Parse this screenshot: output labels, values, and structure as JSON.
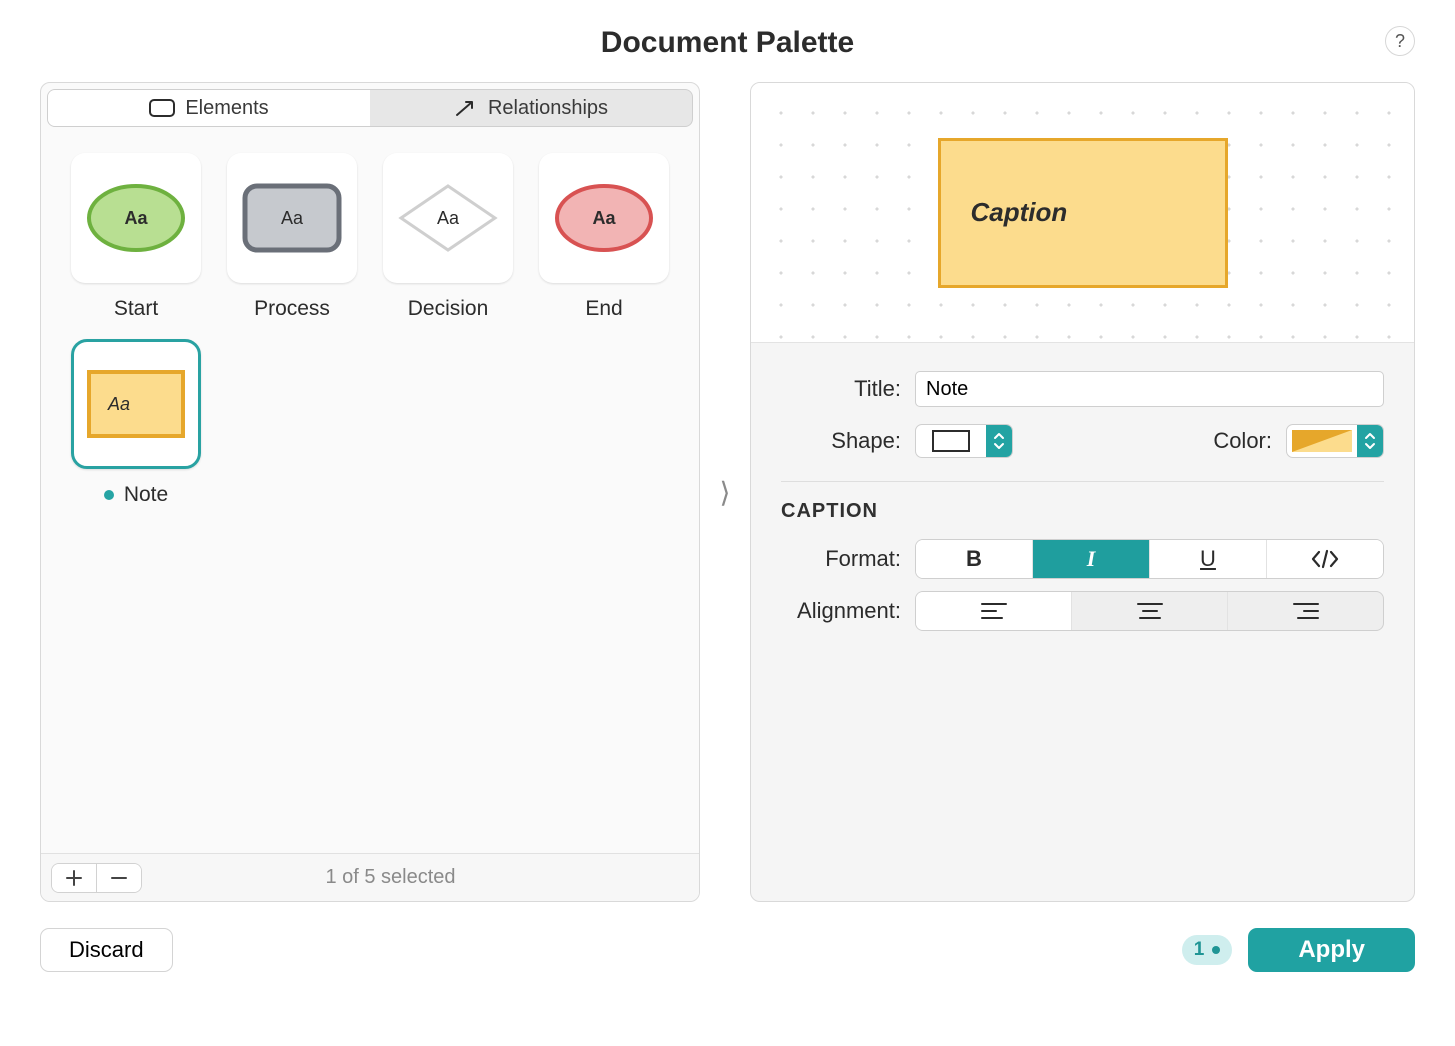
{
  "title": "Document Palette",
  "help_tooltip": "?",
  "tabs": {
    "elements": "Elements",
    "relationships": "Relationships",
    "active": "elements"
  },
  "elements": [
    {
      "id": "start",
      "label": "Start",
      "shape": "ellipse",
      "fill": "#b8df92",
      "stroke": "#6eb13f",
      "caption": "Aa",
      "bold": true,
      "italic": false,
      "selected": false,
      "modified": false
    },
    {
      "id": "process",
      "label": "Process",
      "shape": "roundrect",
      "fill": "#c6c9ce",
      "stroke": "#6a6f78",
      "caption": "Aa",
      "bold": false,
      "italic": false,
      "selected": false,
      "modified": false
    },
    {
      "id": "decision",
      "label": "Decision",
      "shape": "diamond",
      "fill": "#ffffff",
      "stroke": "#cfcfcf",
      "caption": "Aa",
      "bold": false,
      "italic": false,
      "selected": false,
      "modified": false
    },
    {
      "id": "end",
      "label": "End",
      "shape": "ellipse",
      "fill": "#f2b4b4",
      "stroke": "#d85252",
      "caption": "Aa",
      "bold": true,
      "italic": false,
      "selected": false,
      "modified": false
    },
    {
      "id": "note",
      "label": "Note",
      "shape": "rect",
      "fill": "#fcdc8d",
      "stroke": "#e6a72b",
      "caption": "Aa",
      "bold": false,
      "italic": true,
      "selected": true,
      "modified": true
    }
  ],
  "selection_status": "1 of 5 selected",
  "preview": {
    "caption": "Caption"
  },
  "props": {
    "title_label": "Title:",
    "title_value": "Note",
    "shape_label": "Shape:",
    "color_label": "Color:",
    "color_value": "#fcdc8d",
    "color_accent": "#e6a72b"
  },
  "caption_section": {
    "heading": "CAPTION",
    "format_label": "Format:",
    "alignment_label": "Alignment:",
    "format_active": "italic",
    "alignment_active": "left"
  },
  "footer": {
    "discard": "Discard",
    "apply": "Apply",
    "pending_changes": "1"
  }
}
